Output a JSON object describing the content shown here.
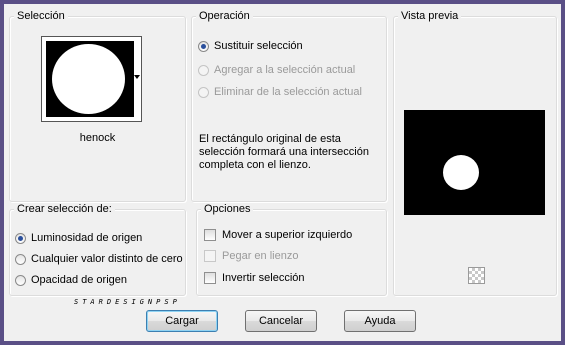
{
  "seleccion": {
    "legend": "Selección",
    "image_name": "henock"
  },
  "operacion": {
    "legend": "Operación",
    "options": [
      {
        "label": "Sustituir selección",
        "checked": true,
        "disabled": false
      },
      {
        "label": "Agregar a la selección actual",
        "checked": false,
        "disabled": true
      },
      {
        "label": "Eliminar de la selección actual",
        "checked": false,
        "disabled": true
      }
    ],
    "description": "El rectángulo original de esta selección formará una intersección completa con el lienzo."
  },
  "vista_previa": {
    "legend": "Vista previa"
  },
  "crear": {
    "legend": "Crear selección de:",
    "options": [
      {
        "label": "Luminosidad de origen",
        "checked": true
      },
      {
        "label": "Cualquier valor distinto de cero",
        "checked": false
      },
      {
        "label": "Opacidad de origen",
        "checked": false
      }
    ]
  },
  "opciones": {
    "legend": "Opciones",
    "options": [
      {
        "label": "Mover a superior izquierdo",
        "checked": false,
        "disabled": false
      },
      {
        "label": "Pegar en lienzo",
        "checked": false,
        "disabled": true
      },
      {
        "label": "Invertir selección",
        "checked": false,
        "disabled": false
      }
    ]
  },
  "watermark": "STARDESIGNPSP",
  "buttons": {
    "load": "Cargar",
    "cancel": "Cancelar",
    "help": "Ayuda"
  },
  "colors": {
    "frame": "#5a4f86",
    "dialog_bg": "#f0f0f0",
    "radio_dot": "#2a4f9c"
  }
}
